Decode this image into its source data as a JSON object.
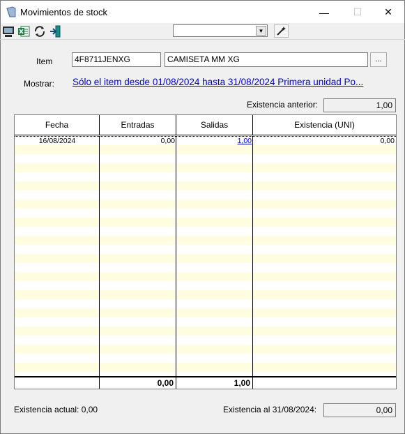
{
  "window": {
    "title": "Movimientos de stock",
    "minimize_glyph": "—",
    "maximize_glyph": "☐",
    "close_glyph": "✕"
  },
  "toolbar": {
    "icons": [
      "monitor-icon",
      "excel-icon",
      "refresh-icon",
      "exit-icon",
      "magic-wand-icon"
    ],
    "combo_value": "",
    "combo_arrow": "▼"
  },
  "item": {
    "label": "Item",
    "code": "4F8711JENXG",
    "description": "CAMISETA MM XG",
    "browse_label": "..."
  },
  "mostrar": {
    "label": "Mostrar:",
    "link": "Sólo el item desde 01/08/2024 hasta 31/08/2024 Primera unidad Po..."
  },
  "existencia_anterior": {
    "label": "Existencia anterior:",
    "value": "1,00"
  },
  "grid": {
    "columns": [
      "Fecha",
      "Entradas",
      "Salidas",
      "Existencia (UNI)"
    ],
    "rows": [
      {
        "fecha": "16/08/2024",
        "entradas": "0,00",
        "salidas": "1,00",
        "existencia": "0,00"
      }
    ],
    "totals": {
      "entradas": "0,00",
      "salidas": "1,00"
    }
  },
  "footer": {
    "existencia_actual": "Existencia actual: 0,00",
    "existencia_al_label": "Existencia al 31/08/2024:",
    "existencia_al_value": "0,00"
  },
  "colors": {
    "link": "#0000cc",
    "alt_row": "#fffde0",
    "window_bg": "#f0f0f0"
  }
}
